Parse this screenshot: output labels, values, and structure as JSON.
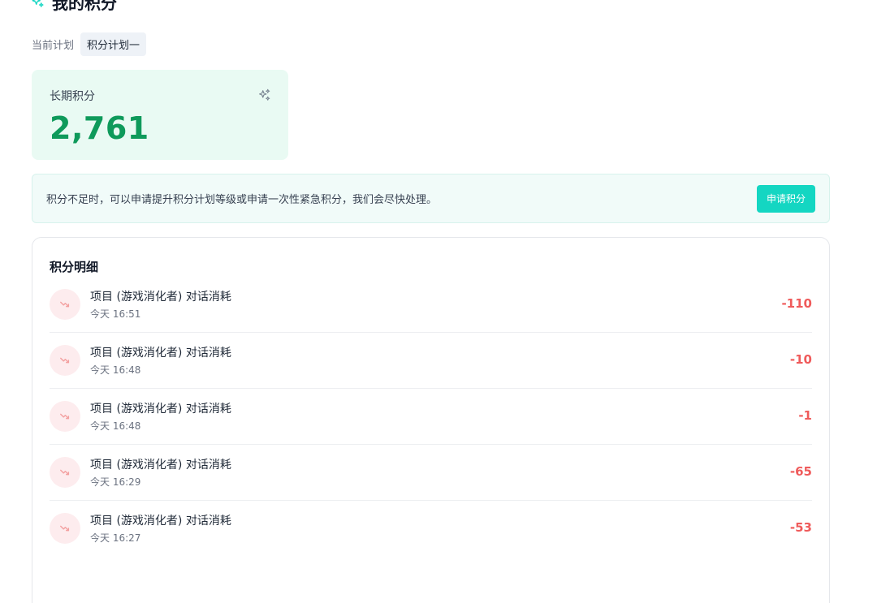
{
  "header": {
    "title": "我的积分",
    "icon": "sparkles-icon"
  },
  "plan": {
    "label": "当前计划",
    "name": "积分计划一"
  },
  "points_card": {
    "label": "长期积分",
    "value": "2,761",
    "icon": "sparkles-icon"
  },
  "notice": {
    "text": "积分不足时，可以申请提升积分计划等级或申请一次性紧急积分，我们会尽快处理。",
    "button_label": "申请积分"
  },
  "details": {
    "title": "积分明细",
    "items": [
      {
        "description": "项目 (游戏消化者) 对话消耗",
        "time": "今天 16:51",
        "amount": "-110"
      },
      {
        "description": "项目 (游戏消化者) 对话消耗",
        "time": "今天 16:48",
        "amount": "-10"
      },
      {
        "description": "项目 (游戏消化者) 对话消耗",
        "time": "今天 16:48",
        "amount": "-1"
      },
      {
        "description": "项目 (游戏消化者) 对话消耗",
        "time": "今天 16:29",
        "amount": "-65"
      },
      {
        "description": "项目 (游戏消化者) 对话消耗",
        "time": "今天 16:27",
        "amount": "-53"
      }
    ]
  },
  "colors": {
    "accent": "#14d6c2",
    "points_value": "#0f9a5b",
    "negative_amount": "#ef5b5b"
  }
}
